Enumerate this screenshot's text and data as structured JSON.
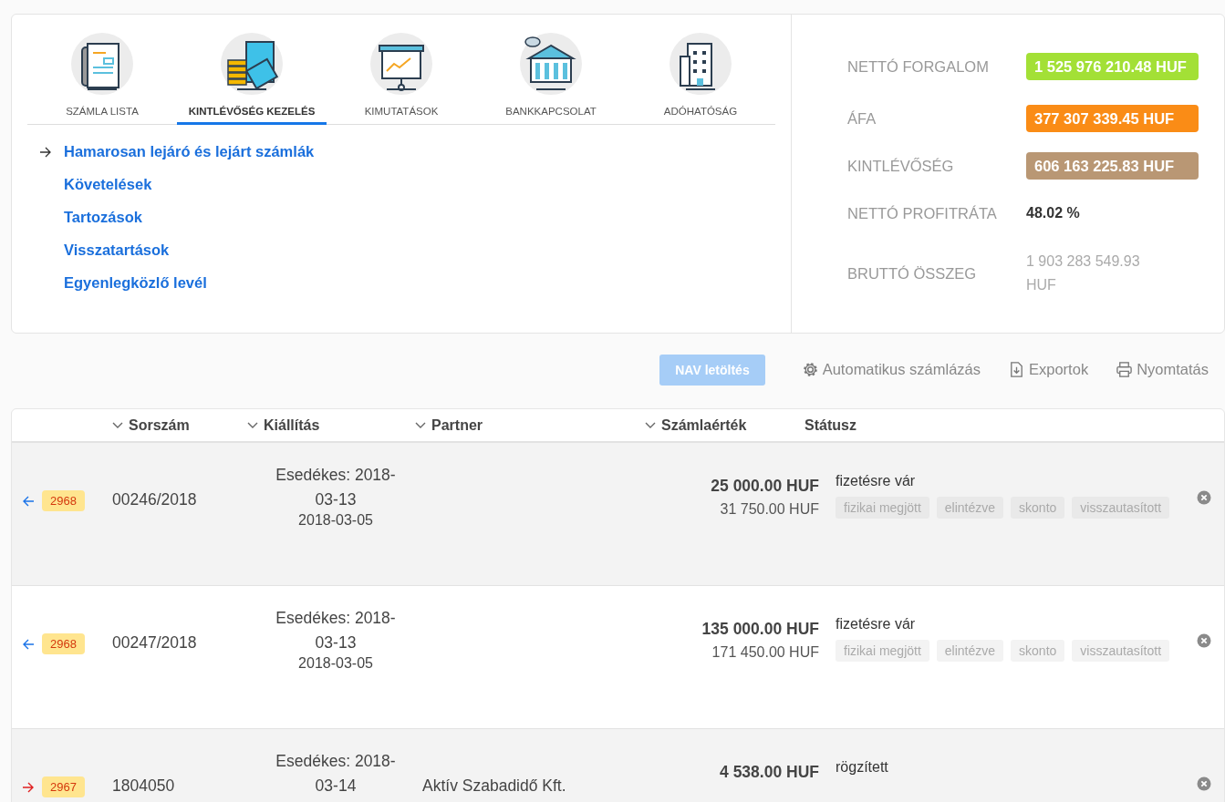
{
  "tabs": [
    {
      "label": "SZÁMLA LISTA",
      "kind": "document",
      "selected": false
    },
    {
      "label": "KINTLÉVŐSÉG KEZELÉS",
      "kind": "money",
      "selected": true
    },
    {
      "label": "KIMUTATÁSOK",
      "kind": "chart",
      "selected": false
    },
    {
      "label": "BANKKAPCSOLAT",
      "kind": "bank",
      "selected": false
    },
    {
      "label": "ADÓHATÓSÁG",
      "kind": "building",
      "selected": false
    }
  ],
  "links": [
    {
      "label": "Hamarosan lejáró és lejárt számlák",
      "selected": true
    },
    {
      "label": "Követelések",
      "selected": false
    },
    {
      "label": "Tartozások",
      "selected": false
    },
    {
      "label": "Visszatartások",
      "selected": false
    },
    {
      "label": "Egyenlegközlő levél",
      "selected": false
    }
  ],
  "metrics": [
    {
      "label": "NETTÓ FORGALOM",
      "value": "1 525 976 210.48 HUF",
      "kind": "badge",
      "color": "#a3e036"
    },
    {
      "label": "ÁFA",
      "value": "377 307 339.45 HUF",
      "kind": "badge",
      "color": "#fa8c16"
    },
    {
      "label": "KINTLÉVŐSÉG",
      "value": "606 163 225.83 HUF",
      "kind": "badge",
      "color": "#b99774"
    },
    {
      "label": "NETTÓ PROFITRÁTA",
      "value": "48.02 %",
      "kind": "strong"
    },
    {
      "label": "BRUTTÓ ÖSSZEG",
      "value": "1 903 283 549.93 HUF",
      "kind": "muted"
    }
  ],
  "toolbar": {
    "primary": {
      "label": "NAV letöltés",
      "disabled": true
    },
    "actions": [
      {
        "label": "Automatikus számlázás",
        "kind": "gear"
      },
      {
        "label": "Exportok",
        "kind": "export"
      },
      {
        "label": "Nyomtatás",
        "kind": "print"
      }
    ]
  },
  "table": {
    "columns": [
      "Sorszám",
      "Kiállítás",
      "Partner",
      "Számlaérték",
      "Státusz"
    ],
    "rows": [
      {
        "kind": "in",
        "badge": "2968",
        "number": "00246/2018",
        "due": "Esedékes: 2018-03-13",
        "issued": "2018-03-05",
        "net": "25 000.00 HUF",
        "gross": "31 750.00 HUF",
        "status": "fizetésre vár",
        "tags": [
          "fizikai megjött",
          "elintézve",
          "skonto",
          "visszautasított"
        ]
      },
      {
        "kind": "in",
        "badge": "2968",
        "number": "00247/2018",
        "due": "Esedékes: 2018-03-13",
        "issued": "2018-03-05",
        "net": "135 000.00 HUF",
        "gross": "171 450.00 HUF",
        "status": "fizetésre vár",
        "tags": [
          "fizikai megjött",
          "elintézve",
          "skonto",
          "visszautasított"
        ]
      },
      {
        "kind": "out",
        "badge": "2967",
        "number": "1804050",
        "due": "Esedékes: 2018-03-14",
        "partner": "Aktív Szabadidő Kft.",
        "net": "4 538.00 HUF",
        "status": "rögzített"
      }
    ]
  }
}
